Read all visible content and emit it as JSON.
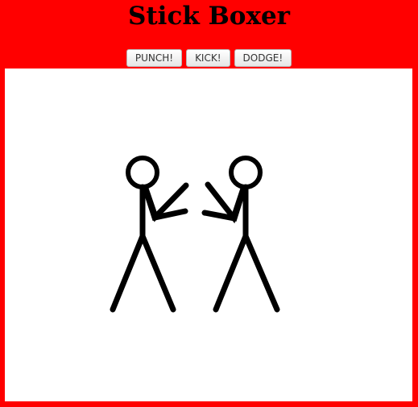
{
  "page": {
    "title": "Stick Boxer"
  },
  "controls": {
    "punch_label": "PUNCH!",
    "kick_label": "KICK!",
    "dodge_label": "DODGE!"
  },
  "colors": {
    "background": "#ff0000",
    "arena": "#ffffff",
    "figure": "#000000"
  }
}
